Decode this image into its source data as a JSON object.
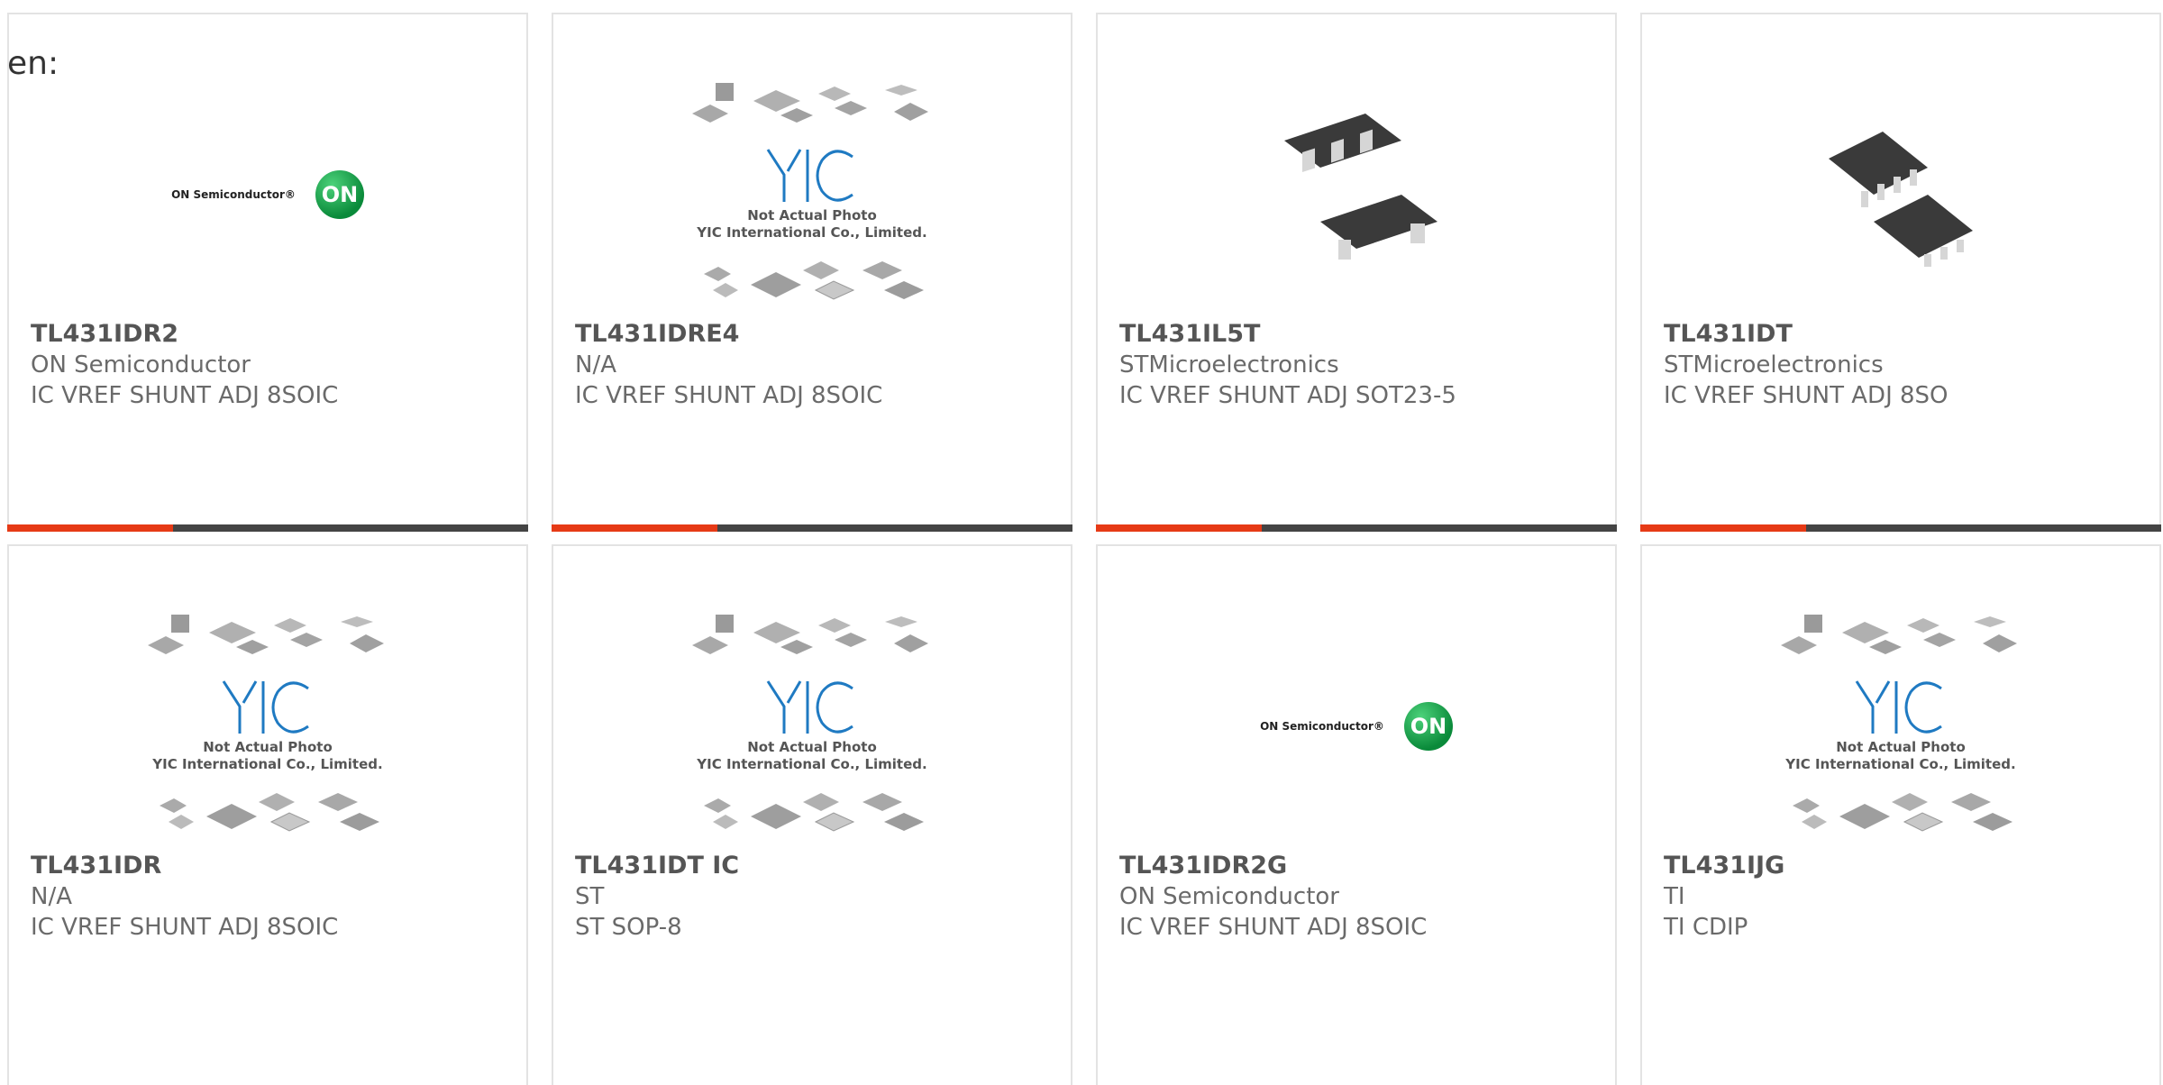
{
  "lang_label": "en:",
  "colors": {
    "accent": "#e63a16",
    "bar": "#444444",
    "yic_blue": "#1f7ac2",
    "on_green": "#0a8a3a"
  },
  "placeholder": {
    "logo_text": "YIC",
    "line1": "Not Actual Photo",
    "line2": "YIC International Co., Limited."
  },
  "on_logo": {
    "wordmark": "ON Semiconductor®",
    "badge": "ON"
  },
  "products": [
    {
      "part": "TL431IDR2",
      "manufacturer": "ON Semiconductor",
      "description": "IC VREF SHUNT ADJ 8SOIC",
      "image": "on-semi-logo"
    },
    {
      "part": "TL431IDRE4",
      "manufacturer": "N/A",
      "description": "IC VREF SHUNT ADJ 8SOIC",
      "image": "yic-placeholder"
    },
    {
      "part": "TL431IL5T",
      "manufacturer": "STMicroelectronics",
      "description": "IC VREF SHUNT ADJ SOT23-5",
      "image": "sot23-photo"
    },
    {
      "part": "TL431IDT",
      "manufacturer": "STMicroelectronics",
      "description": "IC VREF SHUNT ADJ 8SO",
      "image": "so8-photo"
    },
    {
      "part": "TL431IDR",
      "manufacturer": "N/A",
      "description": "IC VREF SHUNT ADJ 8SOIC",
      "image": "yic-placeholder"
    },
    {
      "part": "TL431IDT IC",
      "manufacturer": "ST",
      "description": "ST SOP-8",
      "image": "yic-placeholder"
    },
    {
      "part": "TL431IDR2G",
      "manufacturer": "ON Semiconductor",
      "description": "IC VREF SHUNT ADJ 8SOIC",
      "image": "on-semi-logo"
    },
    {
      "part": "TL431IJG",
      "manufacturer": "TI",
      "description": "TI CDIP",
      "image": "yic-placeholder"
    }
  ]
}
